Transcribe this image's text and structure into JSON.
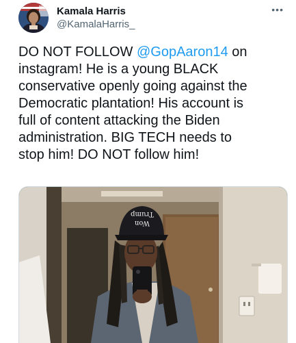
{
  "tweet": {
    "author": {
      "display_name": "Kamala Harris",
      "handle": "@KamalaHarris_"
    },
    "more_label": "•••",
    "text": {
      "part1": "DO NOT FOLLOW ",
      "mention": "@GopAaron14",
      "part2": " on\ninstagram! He is a young BLACK\nconservative openly going against the\nDemocratic plantation! His account is\nfull of content attacking the Biden\nadministration. BIG TECH needs to\nstop him! DO NOT follow him!"
    },
    "media": {
      "hat_text_line1": "Trump",
      "hat_text_line2": "Won"
    }
  },
  "colors": {
    "text": "#0f1419",
    "secondary": "#536471",
    "link": "#1d9bf0"
  }
}
